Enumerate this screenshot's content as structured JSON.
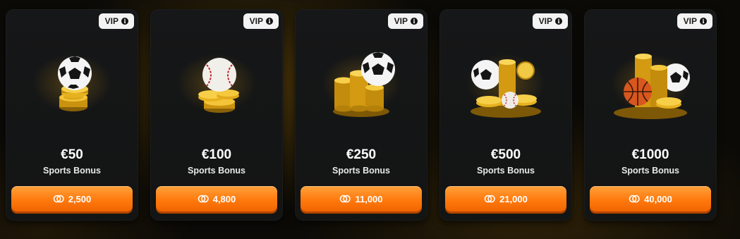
{
  "cards": [
    {
      "vip_label": "VIP",
      "amount": "€50",
      "label": "Sports Bonus",
      "price": "2,500",
      "art": "soccer-ball-on-coins"
    },
    {
      "vip_label": "VIP",
      "amount": "€100",
      "label": "Sports Bonus",
      "price": "4,800",
      "art": "baseball-on-coins"
    },
    {
      "vip_label": "VIP",
      "amount": "€250",
      "label": "Sports Bonus",
      "price": "11,000",
      "art": "coin-stacks-with-soccer-ball"
    },
    {
      "vip_label": "VIP",
      "amount": "€500",
      "label": "Sports Bonus",
      "price": "21,000",
      "art": "coin-pile-with-soccer-ball-and-baseball"
    },
    {
      "vip_label": "VIP",
      "amount": "€1000",
      "label": "Sports Bonus",
      "price": "40,000",
      "art": "coin-pile-with-basketball-and-soccer-ball"
    }
  ],
  "colors": {
    "button": "#ff7a0e",
    "card": "#151616",
    "coin": "#e8b21a"
  }
}
